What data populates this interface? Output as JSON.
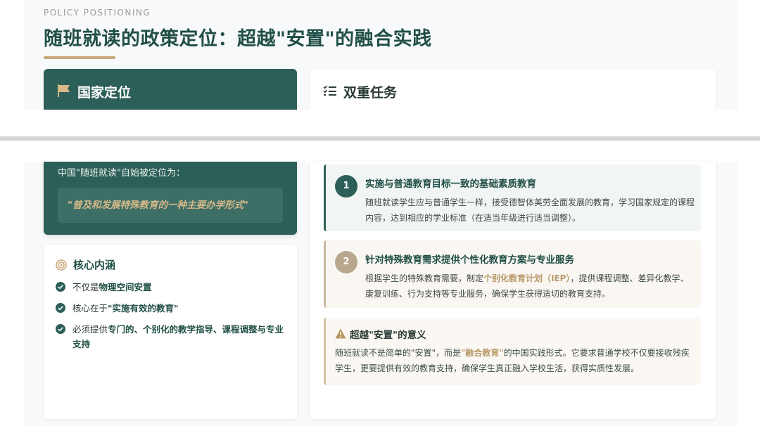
{
  "header": {
    "eyebrow": "POLICY POSITIONING",
    "title": "随班就读的政策定位：超越\"安置\"的融合实践"
  },
  "national": {
    "title": "国家定位",
    "intro": "中国\"随班就读\"自始被定位为：",
    "quote": "\"普及和发展特殊教育的一种主要办学形式\""
  },
  "core": {
    "title": "核心内涵",
    "items": [
      {
        "pre": "不仅是",
        "bold": "物理空间安置",
        "post": ""
      },
      {
        "pre": "核心在于",
        "bold": "\"实施有效的教育\"",
        "post": ""
      },
      {
        "pre": "必须提供",
        "bold": "专门的、个别化的教学指导、课程调整与专业支持",
        "post": ""
      }
    ]
  },
  "dual": {
    "title": "双重任务",
    "tasks": [
      {
        "num": "1",
        "title": "实施与普通教育目标一致的基础素质教育",
        "desc": "随班就读学生应与普通学生一样，接受德智体美劳全面发展的教育，学习国家规定的课程内容，达到相应的学业标准（在适当年级进行适当调整）。"
      },
      {
        "num": "2",
        "title": "针对特殊教育需求提供个性化教育方案与专业服务",
        "desc_pre": "根据学生的特殊教育需要，制定",
        "desc_highlight": "个别化教育计划（IEP）",
        "desc_post": "，提供课程调整、差异化教学、康复训练、行为支持等专业服务，确保学生获得适切的教育支持。"
      }
    ],
    "beyond": {
      "title": "超越\"安置\"的意义",
      "desc_pre": "随班就读不是简单的\"安置\"，而是",
      "desc_highlight": "\"融合教育\"",
      "desc_post": "的中国实践形式。它要求普通学校不仅要接收残疾学生，更要提供有效的教育支持，确保学生真正融入学校生活，获得实质性发展。"
    }
  },
  "colors": {
    "primary": "#2c5f57",
    "accent_gold": "#c9a77b",
    "muted_gold": "#b9a68e"
  }
}
